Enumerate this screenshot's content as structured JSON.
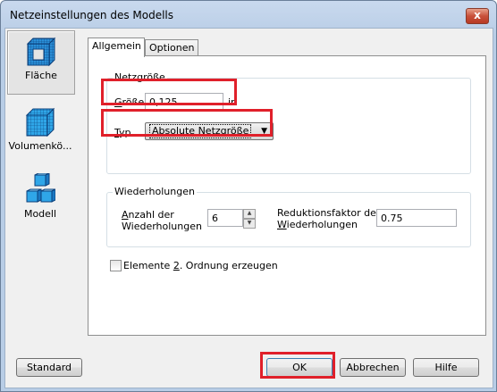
{
  "window": {
    "title": "Netzeinstellungen des Modells",
    "close_label": "x"
  },
  "nav": [
    {
      "label": "Fläche",
      "icon": "surface-mesh-icon",
      "selected": true
    },
    {
      "label": "Volumenkö...",
      "icon": "volume-mesh-icon",
      "selected": false
    },
    {
      "label": "Modell",
      "icon": "model-mesh-icon",
      "selected": false
    }
  ],
  "tabs": [
    {
      "label": "Allgemein",
      "active": true
    },
    {
      "label": "Optionen",
      "active": false
    }
  ],
  "netzgroesse": {
    "title": "Netzgröße",
    "size_label_u": "G",
    "size_label_rest": "röße",
    "size_value": "0,125",
    "size_unit": "in",
    "type_label_u": "T",
    "type_label_rest": "yp",
    "type_value": "Absolute Netzgröße"
  },
  "wiederholungen": {
    "title": "Wiederholungen",
    "count_label_line1_u": "A",
    "count_label_line1_rest": "nzahl der",
    "count_label_line2": "Wiederholungen",
    "count_value": "6",
    "factor_label_line1": "Reduktionsfaktor der",
    "factor_label_line2_u": "W",
    "factor_label_line2_rest": "iederholungen",
    "factor_value": "0.75"
  },
  "second_order": {
    "label_pre": "Elemente ",
    "label_u": "2",
    "label_post": ". Ordnung erzeugen",
    "checked": false
  },
  "buttons": {
    "standard": "Standard",
    "ok": "OK",
    "cancel": "Abbrechen",
    "help": "Hilfe"
  },
  "colors": {
    "highlight": "#e0202a",
    "mesh_blue": "#2a8fd8"
  }
}
